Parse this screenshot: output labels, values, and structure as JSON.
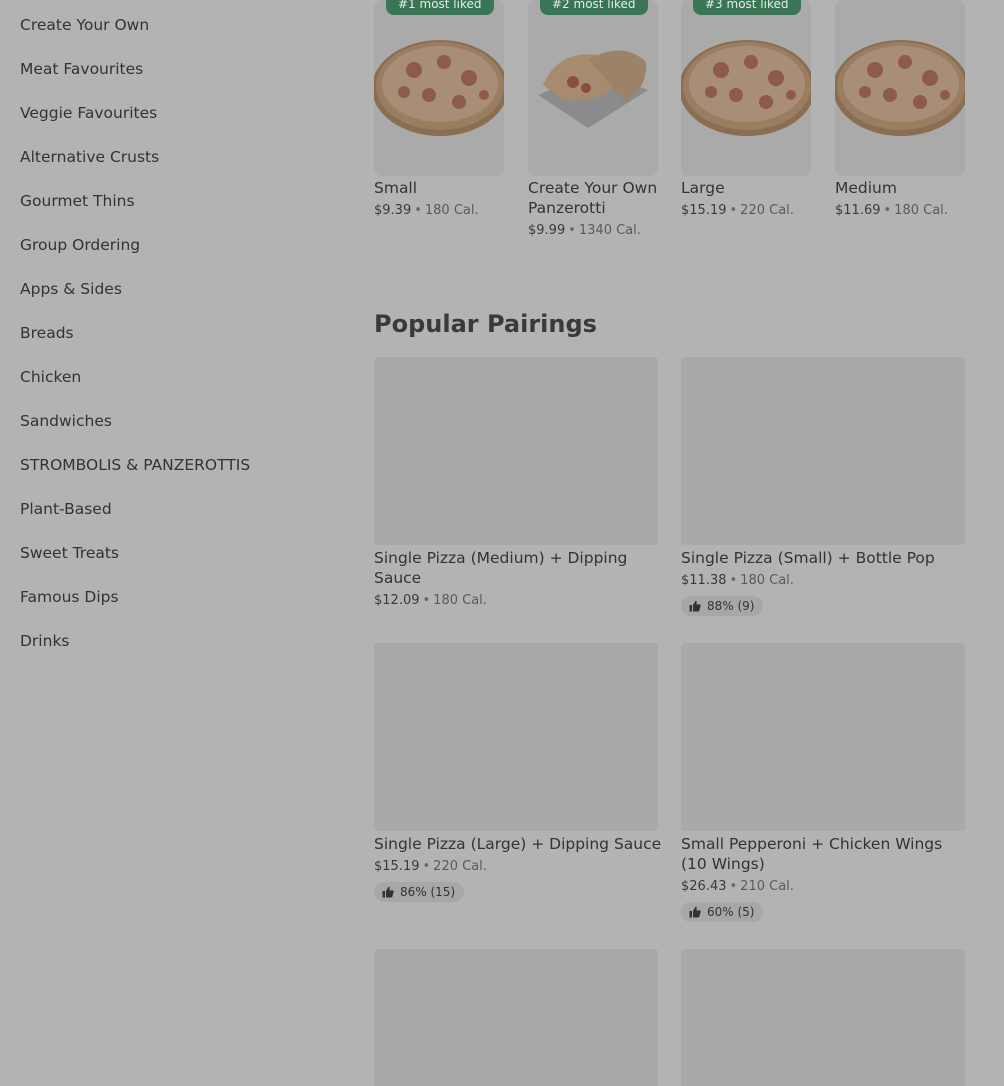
{
  "sidebar": {
    "items": [
      {
        "label": "Create Your Own"
      },
      {
        "label": "Meat Favourites"
      },
      {
        "label": "Veggie Favourites"
      },
      {
        "label": "Alternative Crusts"
      },
      {
        "label": "Gourmet Thins"
      },
      {
        "label": "Group Ordering"
      },
      {
        "label": "Apps & Sides"
      },
      {
        "label": "Breads"
      },
      {
        "label": "Chicken"
      },
      {
        "label": "Sandwiches"
      },
      {
        "label": "STROMBOLIS & PANZEROTTIS"
      },
      {
        "label": "Plant-Based"
      },
      {
        "label": "Sweet Treats"
      },
      {
        "label": "Famous Dips"
      },
      {
        "label": "Drinks"
      }
    ]
  },
  "most_liked": [
    {
      "badge": "#1 most liked",
      "name": "Small",
      "price": "$9.39",
      "cal": "180 Cal.",
      "image": "pizza"
    },
    {
      "badge": "#2 most liked",
      "name": "Create Your Own Panzerotti",
      "price": "$9.99",
      "cal": "1340 Cal.",
      "image": "panzerotti"
    },
    {
      "badge": "#3 most liked",
      "name": "Large",
      "price": "$15.19",
      "cal": "220 Cal.",
      "image": "pizza"
    },
    {
      "badge": "",
      "name": "Medium",
      "price": "$11.69",
      "cal": "180 Cal.",
      "image": "pizza"
    }
  ],
  "pairings": {
    "title": "Popular Pairings",
    "items": [
      {
        "name": "Single Pizza (Medium) + Dipping Sauce",
        "price": "$12.09",
        "cal": "180 Cal.",
        "rating": ""
      },
      {
        "name": "Single Pizza (Small) + Bottle Pop",
        "price": "$11.38",
        "cal": "180 Cal.",
        "rating": "88% (9)"
      },
      {
        "name": "Single Pizza (Large) + Dipping Sauce",
        "price": "$15.19",
        "cal": "220 Cal.",
        "rating": "86% (15)"
      },
      {
        "name": "Small Pepperoni + Chicken Wings (10 Wings)",
        "price": "$26.43",
        "cal": "210 Cal.",
        "rating": "60% (5)"
      }
    ]
  },
  "icons": {
    "rating": "thumbs-up-icon",
    "separator": "•"
  },
  "colors": {
    "badge": "#3a7556",
    "overlay": "#b3b3b3"
  }
}
